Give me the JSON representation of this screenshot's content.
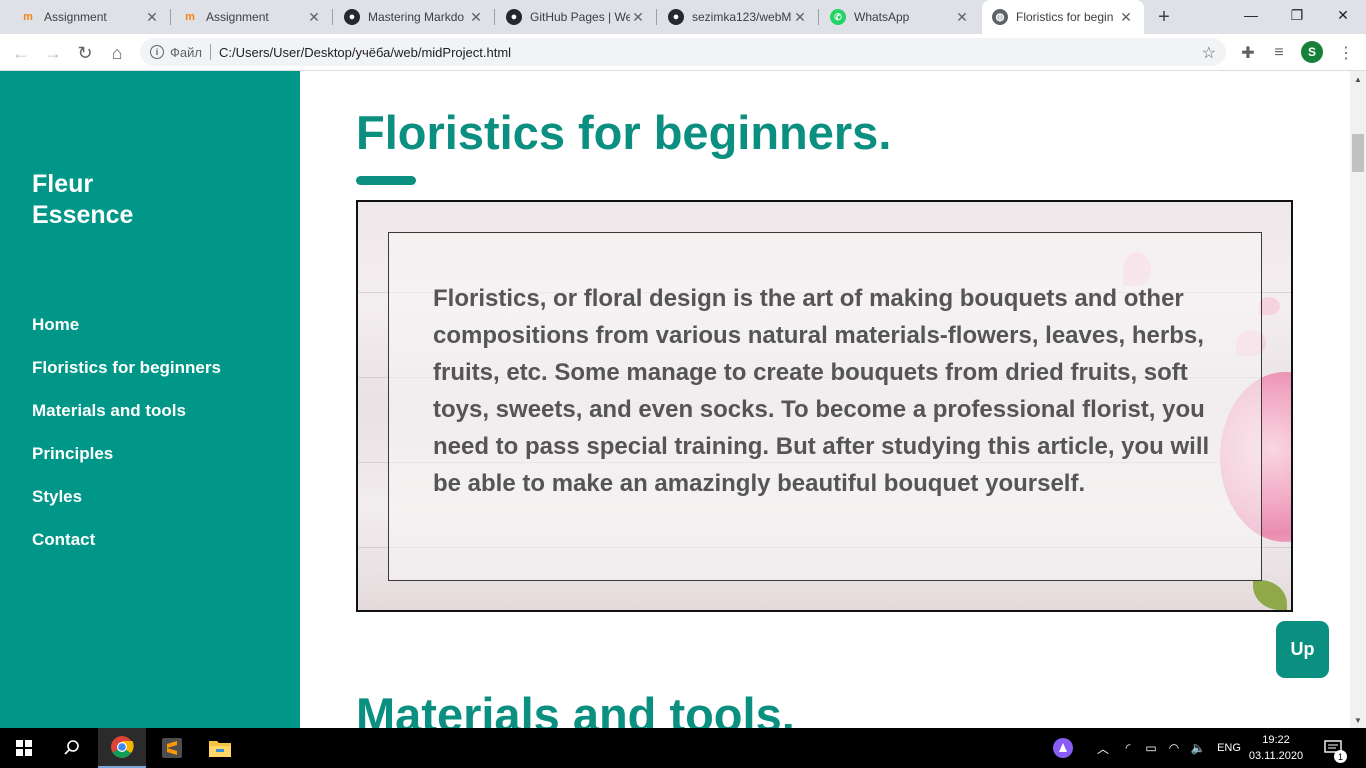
{
  "browser": {
    "tabs": [
      {
        "title": "Assignment",
        "icon": "moodle-icon"
      },
      {
        "title": "Assignment",
        "icon": "moodle-icon"
      },
      {
        "title": "Mastering Markdo",
        "icon": "github-icon"
      },
      {
        "title": "GitHub Pages | We",
        "icon": "github-icon"
      },
      {
        "title": "sezimka123/webM",
        "icon": "github-icon"
      },
      {
        "title": "WhatsApp",
        "icon": "whatsapp-icon"
      },
      {
        "title": "Floristics for begin",
        "icon": "globe-icon"
      }
    ],
    "address": {
      "scheme_label": "Файл",
      "url": "C:/Users/User/Desktop/учёба/web/midProject.html"
    },
    "profile_initial": "S"
  },
  "sidebar": {
    "brand_line1": "Fleur",
    "brand_line2": "Essence",
    "nav": [
      {
        "label": "Home"
      },
      {
        "label": "Floristics for beginners"
      },
      {
        "label": "Materials and tools"
      },
      {
        "label": "Principles"
      },
      {
        "label": "Styles"
      },
      {
        "label": "Contact"
      }
    ]
  },
  "main": {
    "heading": "Floristics for beginners.",
    "paragraph": "Floristics, or floral design is the art of making bouquets and other compositions from various natural materials-flowers, leaves, herbs, fruits, etc. Some manage to create bouquets from dried fruits, soft toys, sweets, and even socks. To become a professional florist, you need to pass special training. But after studying this article, you will be able to make an amazingly beautiful bouquet yourself.",
    "next_heading": "Materials and tools.",
    "up_button": "Up"
  },
  "taskbar": {
    "language": "ENG",
    "time": "19:22",
    "date": "03.11.2020",
    "notification_count": "1"
  },
  "colors": {
    "accent": "#009688",
    "heading": "#0a8f80"
  }
}
